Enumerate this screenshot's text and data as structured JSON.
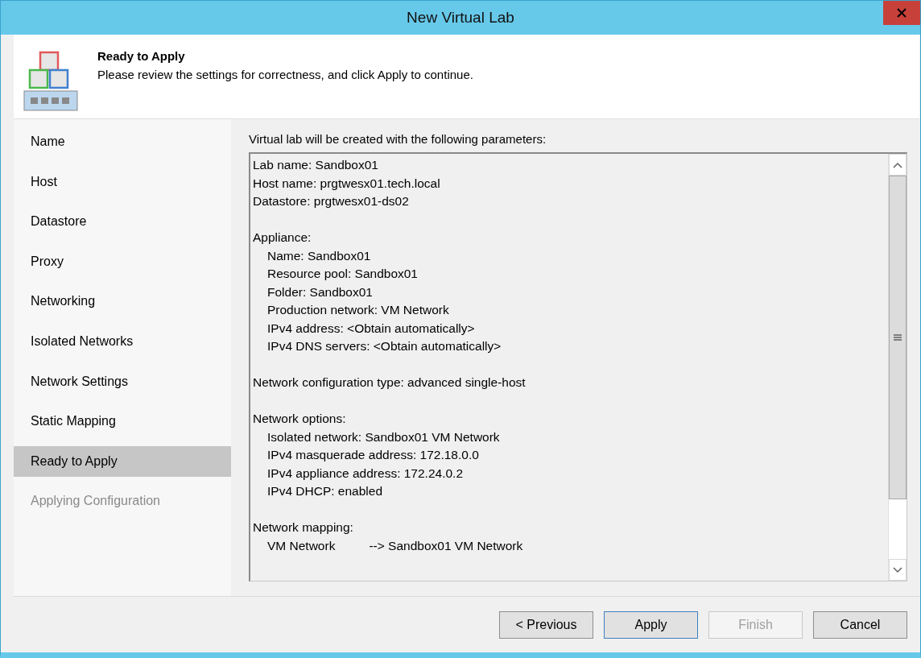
{
  "window": {
    "title": "New Virtual Lab"
  },
  "header": {
    "title": "Ready to Apply",
    "description": "Please review the settings for correctness, and click Apply to continue."
  },
  "sidebar": {
    "items": [
      {
        "label": "Name",
        "selected": false,
        "disabled": false
      },
      {
        "label": "Host",
        "selected": false,
        "disabled": false
      },
      {
        "label": "Datastore",
        "selected": false,
        "disabled": false
      },
      {
        "label": "Proxy",
        "selected": false,
        "disabled": false
      },
      {
        "label": "Networking",
        "selected": false,
        "disabled": false
      },
      {
        "label": "Isolated Networks",
        "selected": false,
        "disabled": false
      },
      {
        "label": "Network Settings",
        "selected": false,
        "disabled": false
      },
      {
        "label": "Static Mapping",
        "selected": false,
        "disabled": false
      },
      {
        "label": "Ready to Apply",
        "selected": true,
        "disabled": false
      },
      {
        "label": "Applying Configuration",
        "selected": false,
        "disabled": true
      }
    ]
  },
  "summary": {
    "caption": "Virtual lab will be created with the following parameters:",
    "sections": [
      [
        {
          "kind": "line",
          "text": "Lab name: Sandbox01"
        },
        {
          "kind": "line",
          "text": "Host name: prgtwesx01.tech.local"
        },
        {
          "kind": "line",
          "text": "Datastore: prgtwesx01-ds02"
        }
      ],
      [
        {
          "kind": "line",
          "text": "Appliance:",
          "children": [
            {
              "kind": "line",
              "text": "Name: Sandbox01"
            },
            {
              "kind": "line",
              "text": "Resource pool: Sandbox01"
            },
            {
              "kind": "line",
              "text": "Folder: Sandbox01"
            },
            {
              "kind": "line",
              "text": "Production network: VM Network"
            },
            {
              "kind": "line",
              "text": "IPv4 address: <Obtain automatically>"
            },
            {
              "kind": "line",
              "text": "IPv4 DNS servers: <Obtain automatically>"
            }
          ]
        }
      ],
      [
        {
          "kind": "line",
          "text": "Network configuration type: advanced single-host"
        }
      ],
      [
        {
          "kind": "line",
          "text": "Network options:",
          "children": [
            {
              "kind": "line",
              "text": "Isolated network: Sandbox01 VM Network"
            },
            {
              "kind": "line",
              "text": "IPv4 masquerade address: 172.18.0.0"
            },
            {
              "kind": "line",
              "text": "IPv4 appliance address: 172.24.0.2"
            },
            {
              "kind": "line",
              "text": "IPv4 DHCP: enabled"
            }
          ]
        }
      ],
      [
        {
          "kind": "line",
          "text": "Network mapping:",
          "children": [
            {
              "kind": "mapping",
              "from": "VM Network",
              "to": "--> Sandbox01 VM Network"
            }
          ]
        }
      ]
    ]
  },
  "buttons": [
    {
      "label": "< Previous",
      "disabled": false,
      "default": false
    },
    {
      "label": "Apply",
      "disabled": false,
      "default": true
    },
    {
      "label": "Finish",
      "disabled": true,
      "default": false
    },
    {
      "label": "Cancel",
      "disabled": false,
      "default": false
    }
  ]
}
